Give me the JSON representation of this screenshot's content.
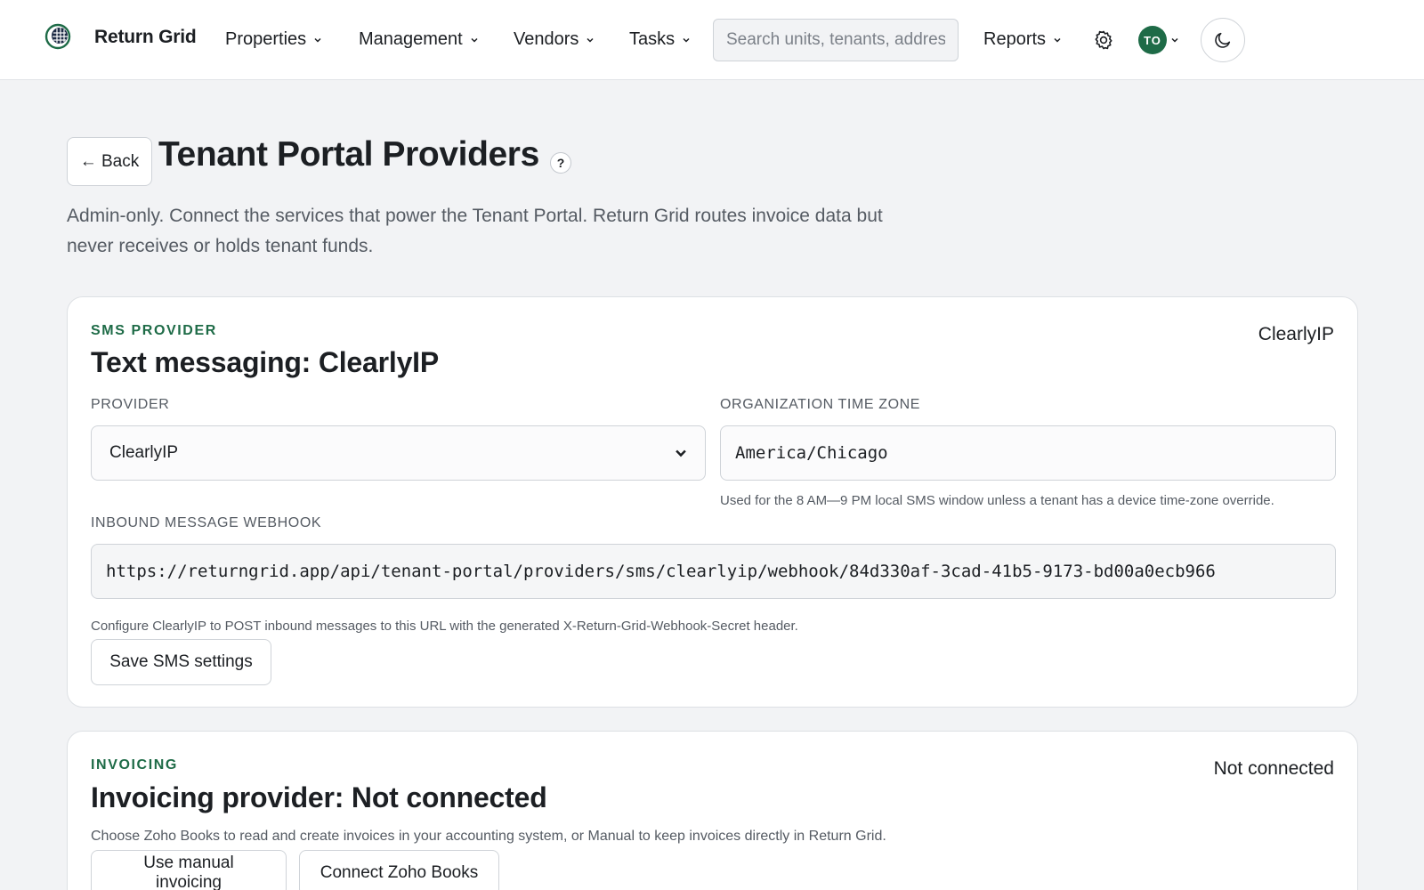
{
  "app": {
    "brand": "Return Grid"
  },
  "nav": {
    "items": [
      {
        "label": "Properties"
      },
      {
        "label": "Management"
      },
      {
        "label": "Vendors"
      },
      {
        "label": "Tasks"
      }
    ],
    "search_placeholder": "Search units, tenants, addresses",
    "reports_label": "Reports",
    "avatar_initials": "TO"
  },
  "header": {
    "back_label": "← Back",
    "title": "Tenant Portal Providers",
    "help_label": "?",
    "subtitle": "Admin-only. Connect the services that power the Tenant Portal. Return Grid routes invoice data but never receives or holds tenant funds."
  },
  "sms": {
    "eyebrow": "SMS PROVIDER",
    "title": "Text messaging: ClearlyIP",
    "status": "ClearlyIP",
    "provider_label": "PROVIDER",
    "provider_value": "ClearlyIP",
    "timezone_label": "ORGANIZATION TIME ZONE",
    "timezone_value": "America/Chicago",
    "timezone_hint": "Used for the 8 AM—9 PM local SMS window unless a tenant has a device time-zone override.",
    "webhook_label": "INBOUND MESSAGE WEBHOOK",
    "webhook_value": "https://returngrid.app/api/tenant-portal/providers/sms/clearlyip/webhook/84d330af-3cad-41b5-9173-bd00a0ecb966",
    "webhook_hint": "Configure ClearlyIP to POST inbound messages to this URL with the generated X-Return-Grid-Webhook-Secret header.",
    "save_label": "Save SMS settings"
  },
  "invoicing": {
    "eyebrow": "INVOICING",
    "title": "Invoicing provider: Not connected",
    "status": "Not connected",
    "hint": "Choose Zoho Books to read and create invoices in your accounting system, or Manual to keep invoices directly in Return Grid.",
    "manual_label": "Use manual invoicing",
    "zoho_label": "Connect Zoho Books"
  },
  "colors": {
    "accent": "#1e6b47",
    "background": "#f2f3f5"
  }
}
